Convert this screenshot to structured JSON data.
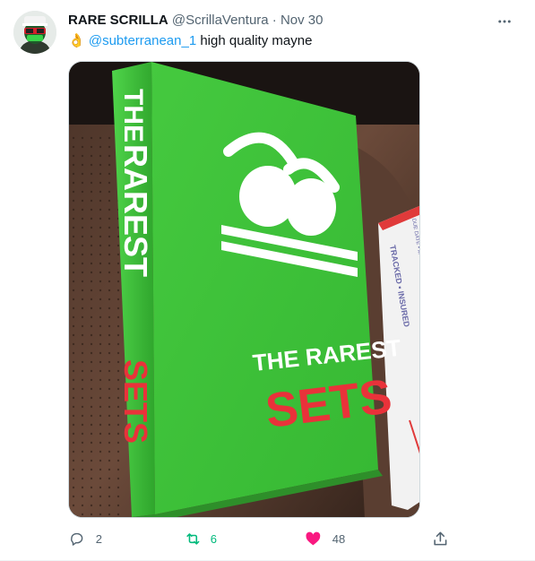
{
  "author": {
    "name": "RARE SCRILLA",
    "handle": "@ScrillaVentura",
    "separator": "·",
    "time": "Nov 30"
  },
  "tweet": {
    "emoji": "👌",
    "mention": "@subterranean_1",
    "text": " high quality mayne"
  },
  "media": {
    "book_spine_top": "THE",
    "book_spine_mid": "RAREST",
    "book_spine_bottom": "SETS",
    "book_cover_line1": "THE RAREST",
    "book_cover_line2": "SETS",
    "envelope_text": "TRACKED ▪ INSURED",
    "envelope_small": "DUE DATE ▪ M"
  },
  "actions": {
    "replies": "2",
    "retweets": "6",
    "likes": "48"
  },
  "colors": {
    "accent": "#1d9bf0",
    "retweet": "#00ba7c",
    "like": "#f91880",
    "book_green": "#3cc03a"
  },
  "icons": {
    "more": "more-icon",
    "reply": "reply-icon",
    "retweet": "retweet-icon",
    "like": "heart-icon",
    "share": "share-icon"
  }
}
